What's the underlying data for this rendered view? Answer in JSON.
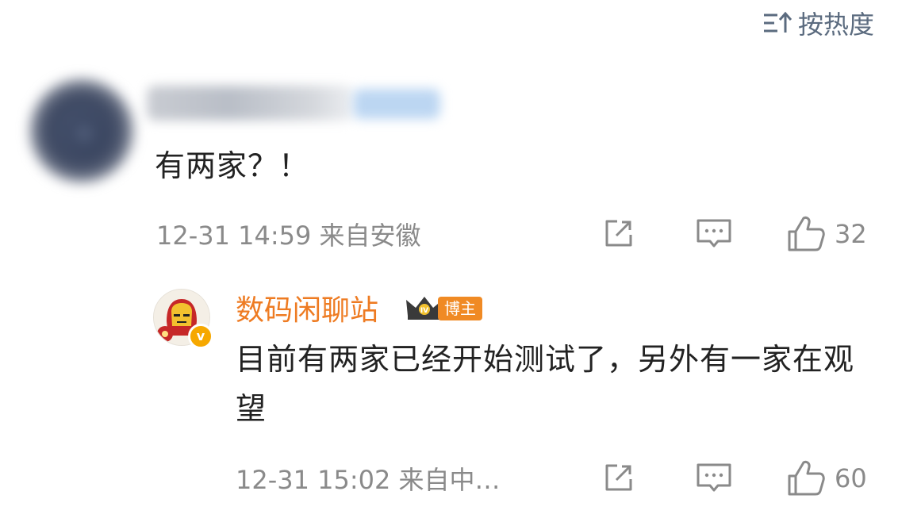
{
  "sort": {
    "label": "按热度",
    "icon": "sort-icon"
  },
  "comments": [
    {
      "author": "",
      "text": "有两家？！",
      "time_location": "12-31 14:59 来自安徽",
      "like_count": "32"
    }
  ],
  "reply": {
    "author": "数码闲聊站",
    "level_badge": "IV",
    "role_badge": "博主",
    "text": "目前有两家已经开始测试了，另外有一家在观望",
    "time_location": "12-31 15:02 来自中…",
    "like_count": "60",
    "accent_color": "#ee7b22"
  },
  "actions": [
    "share-icon",
    "comment-icon",
    "like-icon"
  ]
}
